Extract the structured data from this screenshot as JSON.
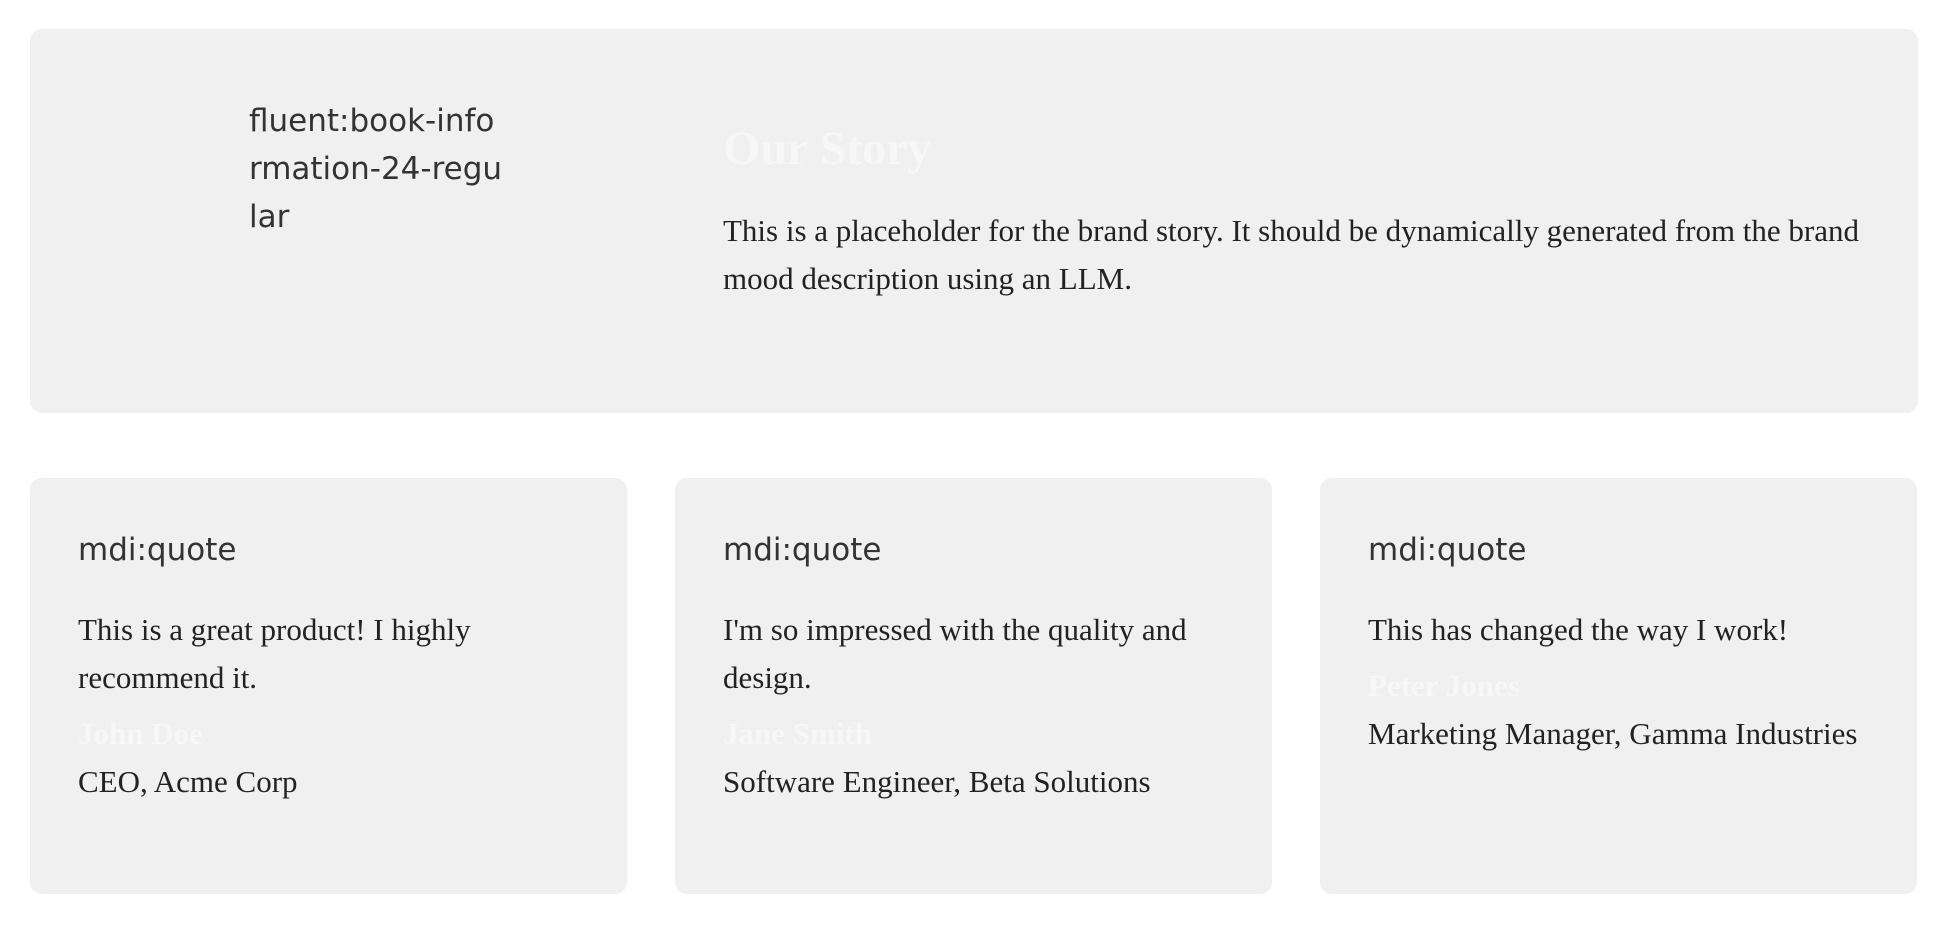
{
  "story": {
    "icon": "fluent:book-information-24-regular",
    "title": "Our Story",
    "text": "This is a placeholder for the brand story. It should be dynamically generated from the brand mood description using an LLM."
  },
  "testimonials": [
    {
      "icon": "mdi:quote",
      "quote": "This is a great product! I highly recommend it.",
      "author": "John Doe",
      "role": "CEO, Acme Corp"
    },
    {
      "icon": "mdi:quote",
      "quote": "I'm so impressed with the quality and design.",
      "author": "Jane Smith",
      "role": "Software Engineer, Beta Solutions"
    },
    {
      "icon": "mdi:quote",
      "quote": "This has changed the way I work!",
      "author": "Peter Jones",
      "role": "Marketing Manager, Gamma Industries"
    }
  ],
  "colors": {
    "page_background": "#ffffff",
    "card_background": "#f0f0f0",
    "body_text": "#222222",
    "heading_text": "#f7f7f7"
  }
}
